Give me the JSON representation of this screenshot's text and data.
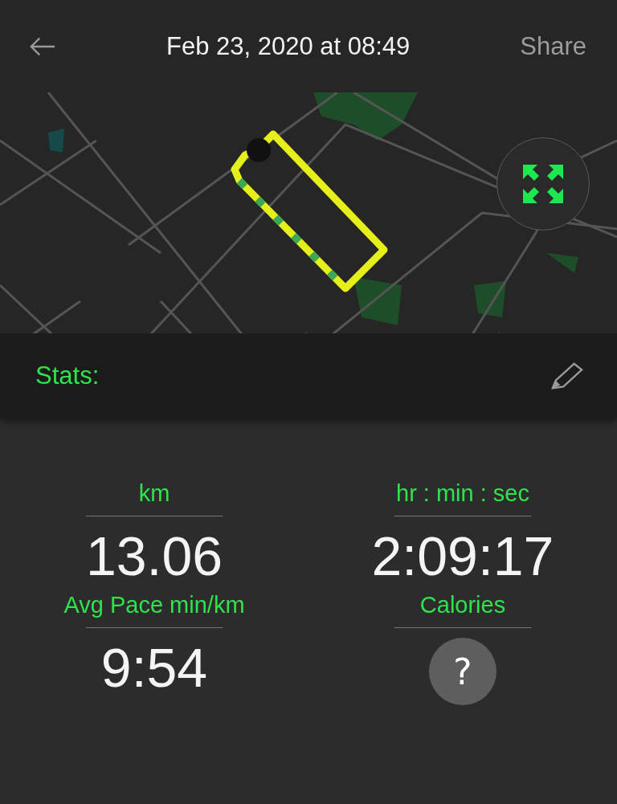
{
  "header": {
    "title": "Feb 23, 2020 at 08:49",
    "action": "Share"
  },
  "stats_bar": {
    "title": "Stats:"
  },
  "stats": [
    {
      "label": "km",
      "value": "13.06",
      "kind": "text"
    },
    {
      "label": "hr : min : sec",
      "value": "2:09:17",
      "kind": "text"
    },
    {
      "label": "Avg Pace min/km",
      "value": "9:54",
      "kind": "text"
    },
    {
      "label": "Calories",
      "value": "?",
      "kind": "unknown"
    }
  ]
}
